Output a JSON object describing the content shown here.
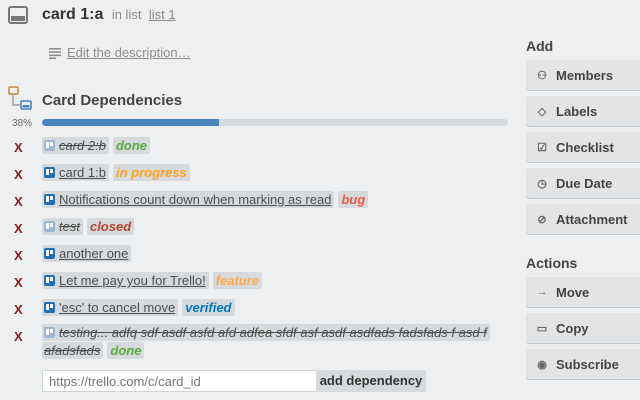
{
  "header": {
    "card_name": "card 1:a",
    "in_list_text": "in list",
    "list_name": "list 1",
    "edit_description": "Edit the description…"
  },
  "dependencies": {
    "heading": "Card Dependencies",
    "progress_label": "38%",
    "progress_fraction": 0.38,
    "remove_glyph": "X",
    "items": [
      {
        "title": "card 2:b",
        "done": true,
        "label": "done",
        "label_color": "#5aac44"
      },
      {
        "title": "card 1:b",
        "done": false,
        "label": "in progress",
        "label_color": "#ff9f1a"
      },
      {
        "title": "Notifications count down when marking as read",
        "done": false,
        "label": "bug",
        "label_color": "#eb5a46"
      },
      {
        "title": "test",
        "done": true,
        "label": "closed",
        "label_color": "#b04632"
      },
      {
        "title": "another one",
        "done": false,
        "label": "",
        "label_color": ""
      },
      {
        "title": "Let me pay you for Trello!",
        "done": false,
        "label": "feature",
        "label_color": "#ffab4a"
      },
      {
        "title": "'esc' to cancel move",
        "done": false,
        "label": "verified",
        "label_color": "#0079bf"
      },
      {
        "title": "testing... adfq sdf asdf asfd afd adfea sfdf asf asdf asdfads fadsfads f asd f afadsfads",
        "done": true,
        "label": "done",
        "label_color": "#5aac44"
      }
    ],
    "input_placeholder": "https://trello.com/c/card_id",
    "add_button": "add dependency"
  },
  "sidebar": {
    "add_heading": "Add",
    "add_buttons": [
      {
        "label": "Members",
        "icon": "person-icon"
      },
      {
        "label": "Labels",
        "icon": "tag-icon"
      },
      {
        "label": "Checklist",
        "icon": "checkbox-icon"
      },
      {
        "label": "Due Date",
        "icon": "clock-icon"
      },
      {
        "label": "Attachment",
        "icon": "paperclip-icon"
      }
    ],
    "actions_heading": "Actions",
    "action_buttons": [
      {
        "label": "Move",
        "icon": "arrow-right-icon"
      },
      {
        "label": "Copy",
        "icon": "card-icon"
      },
      {
        "label": "Subscribe",
        "icon": "eye-icon"
      }
    ]
  }
}
